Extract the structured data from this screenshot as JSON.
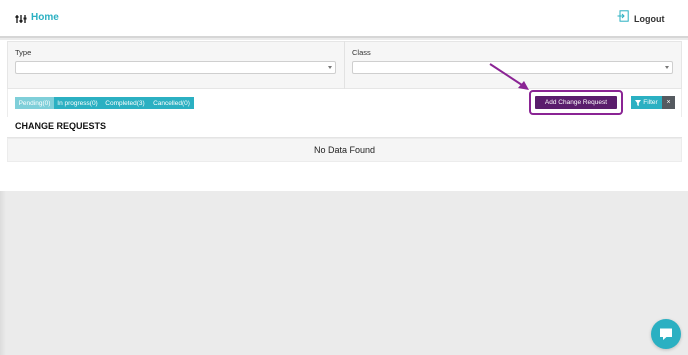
{
  "header": {
    "brand_icon": "sliders-icon",
    "home_label": "Home",
    "logout_icon": "logout-icon",
    "logout_label": "Logout"
  },
  "filters": {
    "type_label": "Type",
    "type_value": "",
    "class_label": "Class",
    "class_value": ""
  },
  "status_tabs": [
    {
      "label": "Pending(0)"
    },
    {
      "label": "In progress(0)"
    },
    {
      "label": "Completed(3)"
    },
    {
      "label": "Cancelled(0)"
    }
  ],
  "actions": {
    "add_change_request_label": "Add Change Request",
    "filter_label": "Filter",
    "clear_label": "×"
  },
  "section": {
    "title": "CHANGE REQUESTS",
    "empty_message": "No Data Found"
  },
  "colors": {
    "accent": "#2bb0c2",
    "pending_tab": "#7fcfd9",
    "primary_button": "#5a1d6c",
    "highlight": "#8a2494",
    "clear_button": "#555a60"
  }
}
